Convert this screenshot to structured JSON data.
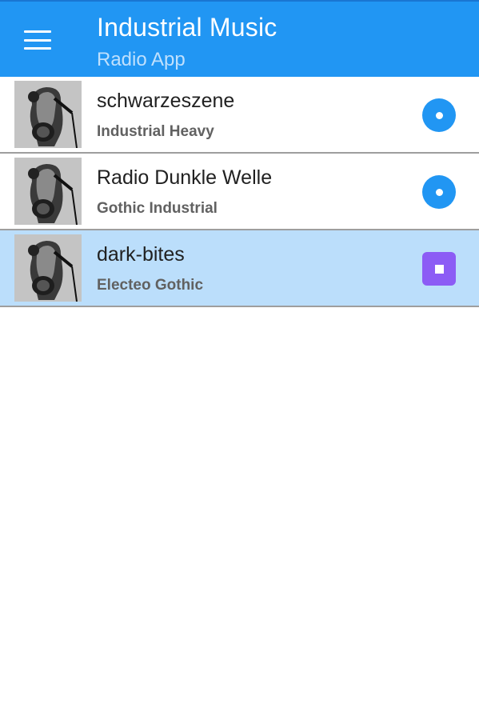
{
  "header": {
    "title": "Industrial Music",
    "subtitle": "Radio App",
    "menu_icon": "hamburger-menu-icon",
    "color": "#2196f3"
  },
  "stations": [
    {
      "name": "schwarzeszene",
      "genre": "Industrial Heavy",
      "state": "play",
      "action_icon": "play-circle-icon"
    },
    {
      "name": "Radio Dunkle Welle",
      "genre": "Gothic Industrial",
      "state": "play",
      "action_icon": "play-circle-icon"
    },
    {
      "name": "dark-bites",
      "genre": "Electeo Gothic",
      "state": "stop",
      "action_icon": "stop-icon"
    }
  ],
  "colors": {
    "accent": "#2196f3",
    "active_row": "#bbdefb",
    "stop_button": "#8c5cf5"
  }
}
